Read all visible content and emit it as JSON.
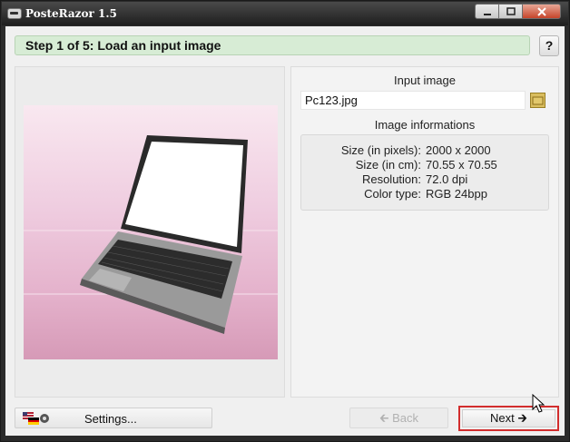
{
  "window": {
    "title": "PosteRazor 1.5",
    "minimize_icon": "minimize-icon",
    "maximize_icon": "maximize-icon",
    "close_icon": "close-icon"
  },
  "step": {
    "title": "Step 1 of 5: Load an input image",
    "help_label": "?"
  },
  "input": {
    "section_title": "Input image",
    "file_name": "Pc123.jpg",
    "browse_icon": "folder-icon"
  },
  "image_info": {
    "section_title": "Image informations",
    "rows": [
      {
        "label": "Size (in pixels):",
        "value": "2000 x 2000"
      },
      {
        "label": "Size (in cm):",
        "value": "70.55 x 70.55"
      },
      {
        "label": "Resolution:",
        "value": "72.0 dpi"
      },
      {
        "label": "Color type:",
        "value": "RGB 24bpp"
      }
    ]
  },
  "buttons": {
    "settings_label": "Settings...",
    "back_label": "Back",
    "next_label": "Next"
  },
  "colors": {
    "step_banner": "#d7ecd5",
    "next_highlight": "#d22d2d"
  }
}
